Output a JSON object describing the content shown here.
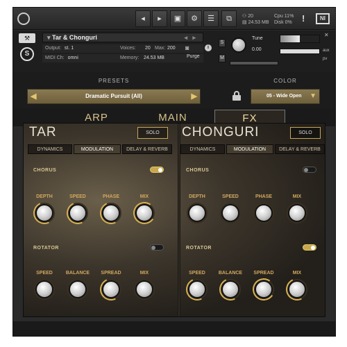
{
  "topbar": {
    "voices_count": "20",
    "memory": "24.53 MB",
    "cpu_label": "Cpu",
    "cpu_value": "11%",
    "disk_label": "Disk",
    "disk_value": "0%",
    "alert": "!"
  },
  "instrument": {
    "name": "Tar & Chonguri",
    "output_label": "Output:",
    "output_value": "st. 1",
    "voices_label": "Voices:",
    "voices_value": "20",
    "max_label": "Max:",
    "max_value": "200",
    "purge": "Purge",
    "midi_label": "MIDI Ch:",
    "midi_value": "omni",
    "memory_label": "Memory:",
    "memory_value": "24.53 MB",
    "tune_label": "Tune",
    "tune_value": "0.00",
    "s_label": "S",
    "m_label": "M",
    "aux_label": "aux",
    "pv_label": "pv"
  },
  "presets": {
    "label": "PRESETS",
    "current": "Dramatic Pursuit (All)"
  },
  "color": {
    "label": "COLOR",
    "current": "05 - Wide Open"
  },
  "tabs": [
    "ARP",
    "MAIN",
    "FX"
  ],
  "active_tab": "FX",
  "instruments": [
    {
      "title": "TAR",
      "solo": "SOLO",
      "subtabs": [
        "DYNAMICS",
        "MODULATION",
        "DELAY & REVERB"
      ],
      "chorus": {
        "label": "CHORUS",
        "on": true,
        "knobs": [
          "DEPTH",
          "SPEED",
          "PHASE",
          "MIX"
        ]
      },
      "rotator": {
        "label": "ROTATOR",
        "on": false,
        "knobs": [
          "SPEED",
          "BALANCE",
          "SPREAD",
          "MIX"
        ]
      }
    },
    {
      "title": "CHONGURI",
      "solo": "SOLO",
      "subtabs": [
        "DYNAMICS",
        "MODULATION",
        "DELAY & REVERB"
      ],
      "chorus": {
        "label": "CHORUS",
        "on": false,
        "knobs": [
          "DEPTH",
          "SPEED",
          "PHASE",
          "MIX"
        ]
      },
      "rotator": {
        "label": "ROTATOR",
        "on": true,
        "knobs": [
          "SPEED",
          "BALANCE",
          "SPREAD",
          "MIX"
        ]
      }
    }
  ]
}
